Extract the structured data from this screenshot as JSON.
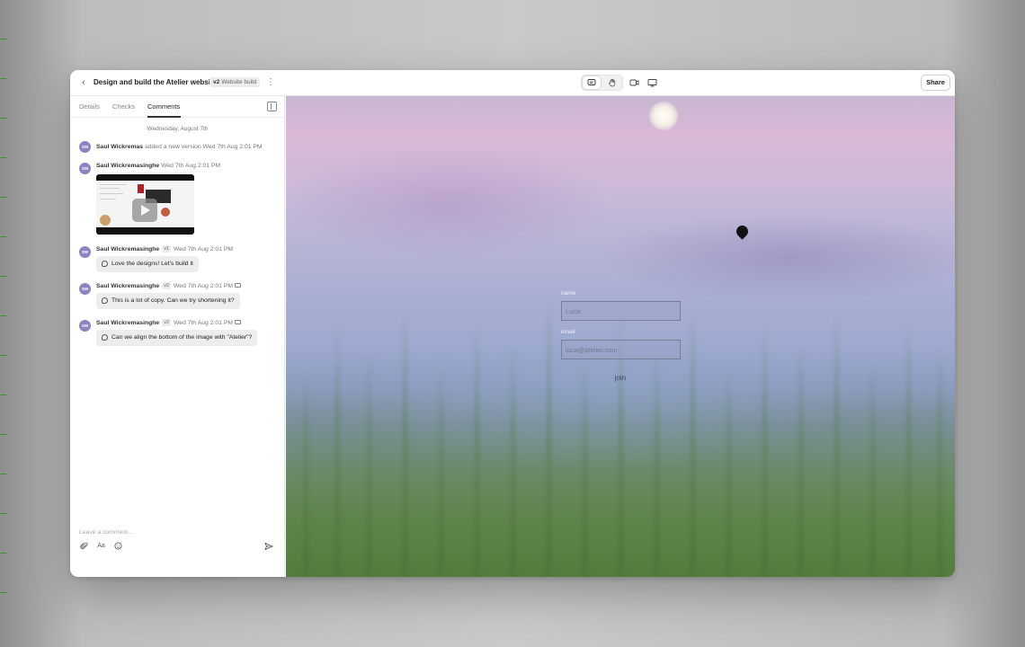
{
  "header": {
    "back_icon": "chevron-left-icon",
    "title": "Design and build the Atelier website",
    "version_badge_version": "v2",
    "version_badge_label": "Website build",
    "more_icon": "more-vertical-icon",
    "tools": [
      {
        "name": "comment-tool",
        "icon": "comment-icon",
        "active": true
      },
      {
        "name": "hand-tool",
        "icon": "hand-icon",
        "active": false
      },
      {
        "name": "video-call",
        "icon": "video-camera-icon",
        "active": false
      },
      {
        "name": "present",
        "icon": "monitor-icon",
        "active": false
      }
    ],
    "share_label": "Share"
  },
  "sidebar": {
    "tabs": [
      {
        "label": "Details",
        "active": false
      },
      {
        "label": "Checks",
        "active": false
      },
      {
        "label": "Comments",
        "active": true
      }
    ],
    "date_separator": "Wednesday, August 7th",
    "activity": [
      {
        "initials": "SW",
        "name": "Saul Wickremas",
        "text": "added a new version",
        "timestamp": "Wed 7th Aug 2:01 PM"
      },
      {
        "initials": "SW",
        "name": "Saul Wickremasinghe",
        "timestamp": "Wed 7th Aug 2:01 PM",
        "attachment": "video"
      },
      {
        "initials": "SW",
        "name": "Saul Wickremasinghe",
        "version": "v1",
        "timestamp": "Wed 7th Aug 2:01 PM",
        "comment": "Love the designs! Let's build it"
      },
      {
        "initials": "SW",
        "name": "Saul Wickremasinghe",
        "version": "v2",
        "timestamp": "Wed 7th Aug 2:01 PM",
        "comment": "This is a lot of copy. Can we try shortening it?"
      },
      {
        "initials": "SW",
        "name": "Saul Wickremasinghe",
        "version": "v2",
        "timestamp": "Wed 7th Aug 2:01 PM",
        "comment": "Can we align the bottom of the image with \"Atelier\"?"
      }
    ],
    "composer": {
      "placeholder": "Leave a comment...",
      "icons": [
        "paperclip-icon",
        "text-format-icon",
        "emoji-icon",
        "send-icon"
      ],
      "text_format_label": "Aa"
    }
  },
  "canvas": {
    "form": {
      "name_label": "name",
      "name_placeholder": "Luca",
      "email_label": "email",
      "email_placeholder": "luca@atelier.com",
      "join_label": "join"
    }
  },
  "colors": {
    "avatar": "#8d85c2",
    "sky_top": "#d9b9d6",
    "grass": "#547b3c"
  }
}
